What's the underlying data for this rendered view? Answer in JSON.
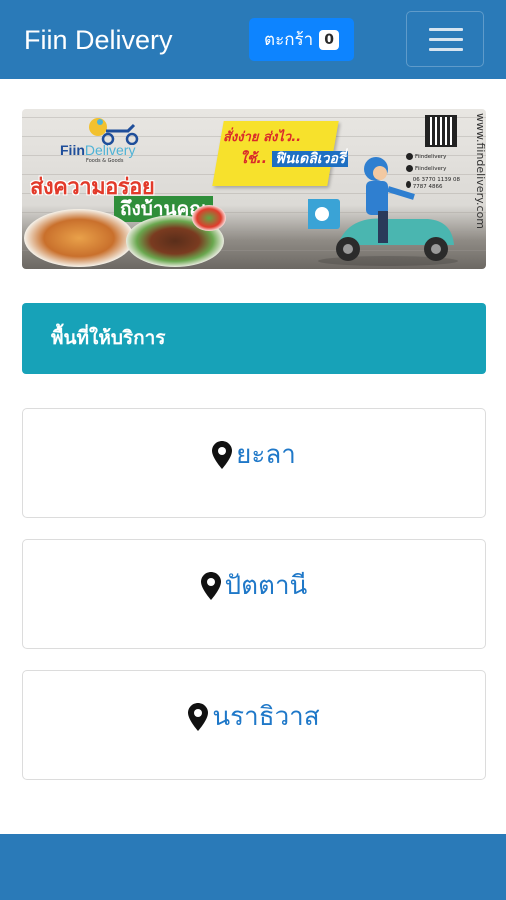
{
  "header": {
    "brand": "Fiin Delivery",
    "cart_label": "ตะกร้า",
    "cart_count": "0",
    "menu_icon": "hamburger-icon"
  },
  "banner": {
    "logo_fiin": "Fiin",
    "logo_delivery": "Delivery",
    "logo_sub": "Foods & Goods",
    "slogan_line1": "ส่งความอร่อย",
    "slogan_line2": "ถึงบ้านคุณ",
    "sign_line1": "สั่งง่าย ส่งไว..",
    "sign_line2_prefix": "ใช้..",
    "sign_line2_brand": "ฟินเดลิเวอรี่",
    "url": "www.fiindelivery.com",
    "contact_facebook": "Fiindelivery",
    "contact_line": "Fiindelivery",
    "contact_phone": "06 3770 1139  08 7787 4866"
  },
  "section": {
    "title": "พื้นที่ให้บริการ"
  },
  "areas": [
    {
      "name": "ยะลา",
      "icon": "map-pin-icon"
    },
    {
      "name": "ปัตตานี",
      "icon": "map-pin-icon"
    },
    {
      "name": "นราธิวาส",
      "icon": "map-pin-icon"
    }
  ],
  "colors": {
    "navbar": "#2a7ab8",
    "cart_button": "#0d84ff",
    "section_header": "#17a2b8",
    "area_text": "#1f78c8"
  }
}
